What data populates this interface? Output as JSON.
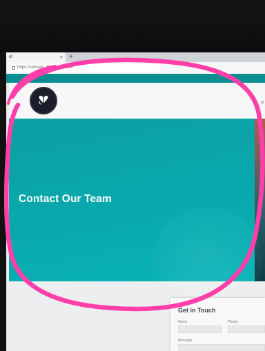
{
  "browser": {
    "tab_title": "nt",
    "tab_close": "×",
    "new_tab": "+",
    "url": "https://contact...ify.app/contact"
  },
  "header": {
    "nav_partial": "ni"
  },
  "hero": {
    "title": "Contact Our Team"
  },
  "contact_form": {
    "title": "Get in Touch",
    "name_label": "Name",
    "phone_label": "Phone",
    "message_label": "Message"
  },
  "colors": {
    "hero": "#0aa7ab",
    "annotation": "#ff3fa9",
    "logo": "#1b1d2a"
  },
  "icons": [
    "lock-icon",
    "logo-heart-icon"
  ]
}
